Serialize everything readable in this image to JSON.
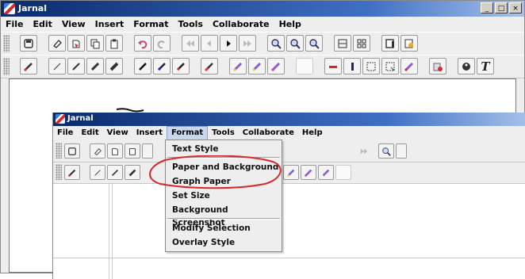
{
  "app": {
    "title": "Jarnal"
  },
  "window_controls": {
    "minimize": "_",
    "maximize": "□",
    "close": "×"
  },
  "menu": [
    "File",
    "Edit",
    "View",
    "Insert",
    "Format",
    "Tools",
    "Collaborate",
    "Help"
  ],
  "toolbar1_icons": [
    "save-icon",
    "eraser-icon",
    "stamp-icon",
    "copy-icon",
    "paste-icon",
    "undo-icon",
    "redo-icon",
    "first-page-icon",
    "prev-page-icon",
    "next-page-icon",
    "last-page-icon",
    "zoom-in-icon",
    "zoom-out-icon",
    "zoom-fit-icon",
    "page-layout-icon",
    "grid-layout-icon",
    "new-page-icon",
    "page-settings-icon"
  ],
  "toolbar2_icons": [
    "pen-icon",
    "fine-pen-icon",
    "medium-pen-icon",
    "heavy-pen-icon",
    "fat-pen-icon",
    "black-pen-icon",
    "blue-pen-icon",
    "red-pen-icon",
    "highlighter-icon",
    "yellow-highlighter-icon",
    "green-highlighter-icon",
    "magenta-highlighter-icon",
    "white-pen-icon",
    "red-line-icon",
    "blue-line-icon",
    "select-rect-icon",
    "select-lasso-icon",
    "marker-icon",
    "clear-icon",
    "palette-icon",
    "text-tool-icon"
  ],
  "inner": {
    "title": "Jarnal",
    "menu": [
      "File",
      "Edit",
      "View",
      "Insert",
      "Format",
      "Tools",
      "Collaborate",
      "Help"
    ],
    "active_menu": "Format"
  },
  "format_menu": {
    "items": [
      "Text Style",
      "Paper and Background",
      "Graph Paper",
      "Set Size",
      "Background Screenshot",
      "Modify Selection",
      "Overlay Style"
    ]
  },
  "colors": {
    "annotation": "#d8262b",
    "title_start": "#0a2a6b",
    "title_end": "#a6c2ea"
  }
}
